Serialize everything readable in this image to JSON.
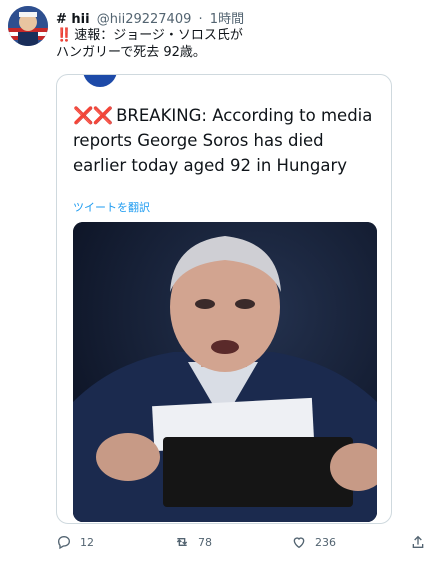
{
  "tweet": {
    "display_name": "# hii",
    "handle": "@hii29227409",
    "separator": "·",
    "time": "1時間",
    "bang": "‼️",
    "text_line1": "速報：ジョージ・ソロス氏が",
    "text_line2": "ハンガリーで死去 92歳。"
  },
  "quote": {
    "xx": "❌❌",
    "breaking_text": "BREAKING: According to media reports George Soros has died earlier today aged 92 in Hungary",
    "translate_link": "ツイートを翻訳"
  },
  "actions": {
    "reply_count": "12",
    "retweet_count": "78",
    "like_count": "236"
  },
  "icons": {
    "reply": "reply-icon",
    "retweet": "retweet-icon",
    "like": "like-icon",
    "share": "share-icon"
  },
  "colors": {
    "link": "#1d9bf0",
    "alert_red": "#d21f1f",
    "muted": "#536471",
    "border": "#cfd9de"
  }
}
